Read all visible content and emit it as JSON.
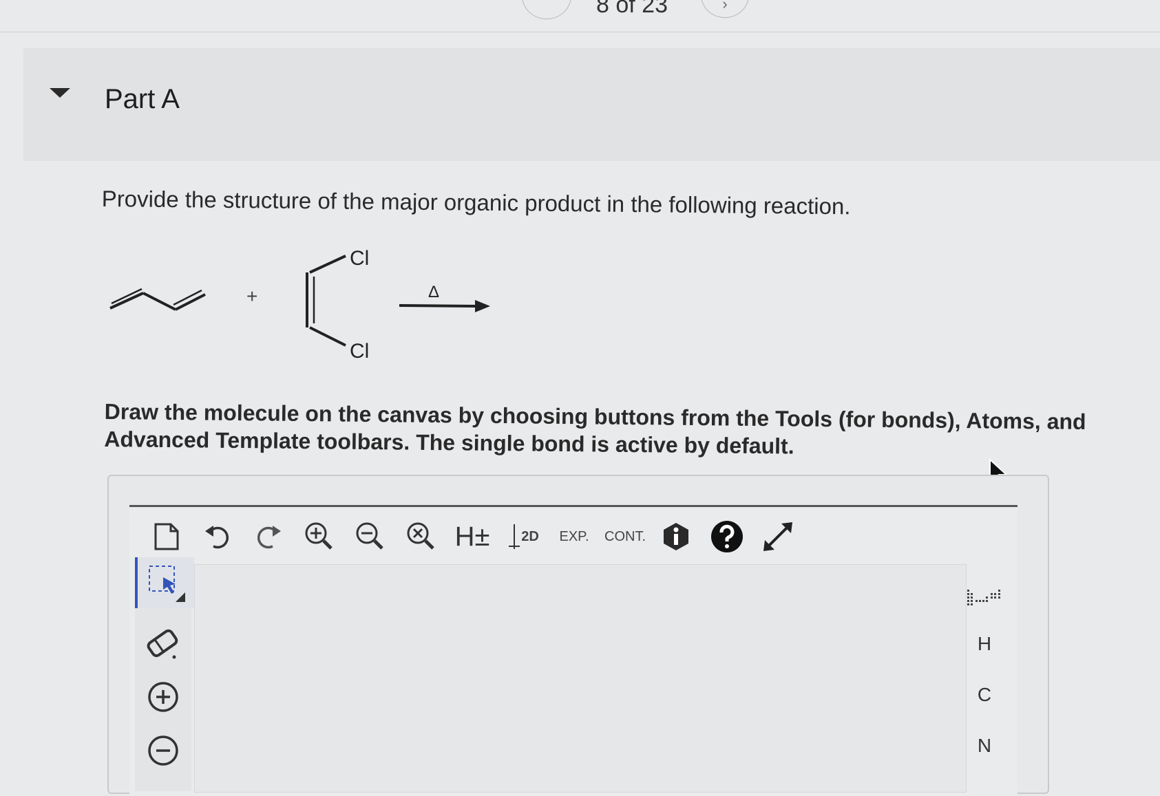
{
  "pager": {
    "text": "8 of 23",
    "next_symbol": "›"
  },
  "part": {
    "title": "Part A"
  },
  "question": {
    "text": "Provide the structure of the major organic product in the following reaction."
  },
  "reaction": {
    "plus": "+",
    "atom_top": "Cl",
    "atom_bottom": "Cl",
    "condition": "Δ"
  },
  "instructions": {
    "text": "Draw the molecule on the canvas by choosing buttons from the Tools (for bonds), Atoms, and Advanced Template toolbars. The single bond is active by default."
  },
  "toolbar": {
    "items": [
      "new-document-icon",
      "undo-icon",
      "redo-icon",
      "zoom-in-icon",
      "zoom-out-icon",
      "zoom-reset-icon",
      "h-toggle",
      "clean-2d",
      "expand",
      "contract",
      "info-icon",
      "help-icon",
      "fullscreen-icon"
    ],
    "h_label": "H±",
    "clean_label": "2D",
    "exp_label": "EXP.",
    "cont_label": "CONT."
  },
  "left_tools": [
    "select-icon",
    "eraser-icon",
    "charge-plus-icon",
    "charge-minus-icon"
  ],
  "atoms": {
    "h": "H",
    "c": "C",
    "n": "N"
  }
}
